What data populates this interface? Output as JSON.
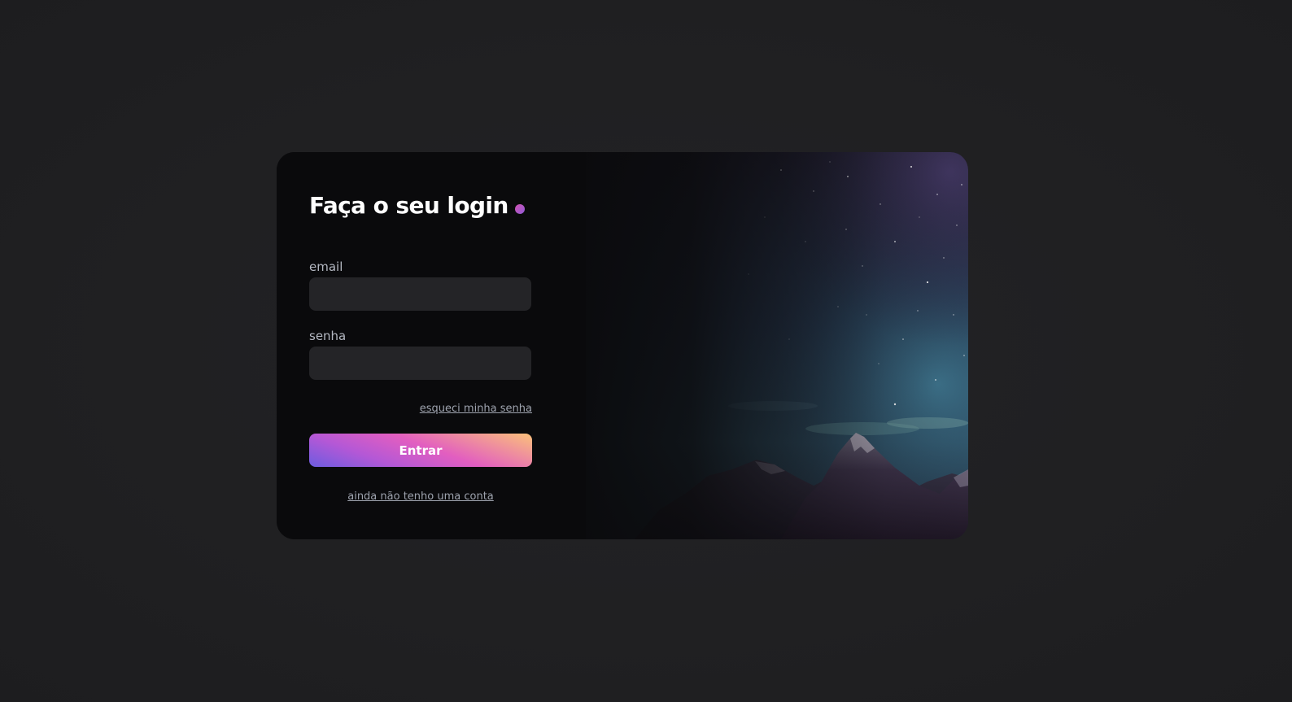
{
  "login": {
    "title": "Faça o seu login",
    "email_label": "email",
    "email_value": "",
    "password_label": "senha",
    "password_value": "",
    "forgot_link": "esqueci minha senha",
    "submit_label": "Entrar",
    "signup_link": "ainda não tenho uma conta"
  },
  "colors": {
    "background": "#202022",
    "card": "#0a0a0c",
    "input": "#242427",
    "label": "#b4b8c2",
    "link": "#9ea3ae",
    "accent_pink": "#e25ec0",
    "accent_purple": "#6c5ce0",
    "accent_orange": "#fbc17a"
  },
  "icons": {
    "title_dot": "gradient-dot-icon"
  }
}
